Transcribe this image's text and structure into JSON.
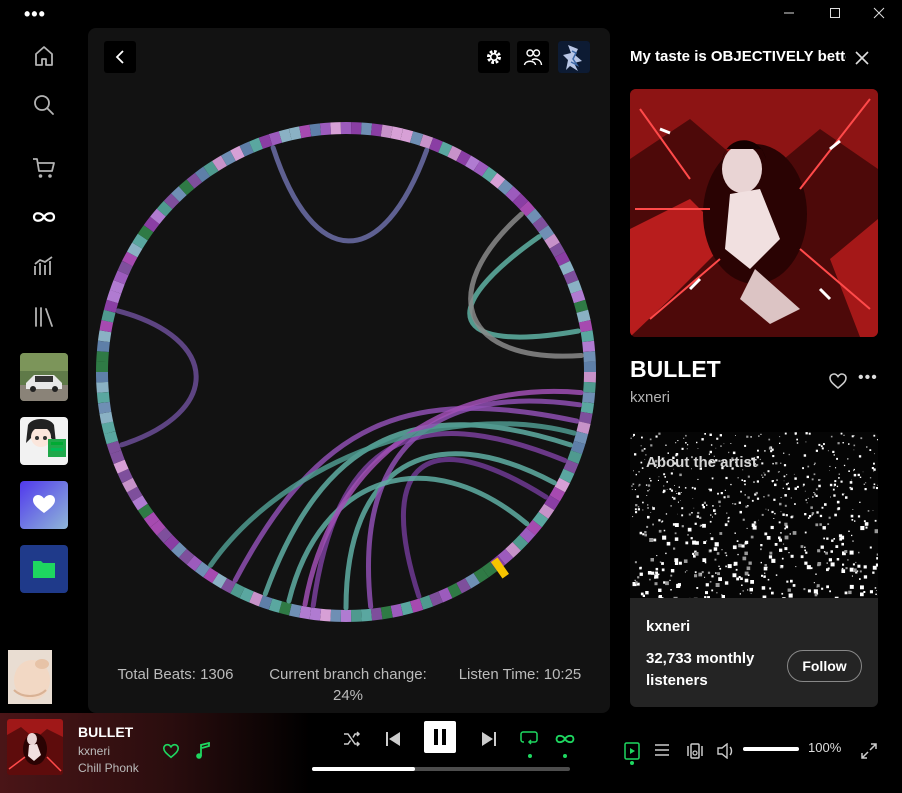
{
  "app": {
    "menu_icon": "three-dots-icon",
    "window_controls": [
      "minimize-icon",
      "maximize-icon",
      "close-icon"
    ]
  },
  "sidebar": {
    "items": [
      {
        "icon": "home-icon"
      },
      {
        "icon": "search-icon"
      },
      {
        "icon": "cart-icon"
      },
      {
        "icon": "infinity-icon"
      },
      {
        "icon": "stats-icon"
      },
      {
        "icon": "library-icon"
      }
    ],
    "playlists": [
      {
        "icon": "car-playlist-thumb"
      },
      {
        "icon": "anime-playlist-thumb"
      },
      {
        "icon": "liked-songs-heart-icon",
        "color": "#7b5cf5"
      },
      {
        "icon": "local-files-folder-icon",
        "color": "#1f3a8a"
      }
    ]
  },
  "visualizer": {
    "toolbar": [
      "back-icon",
      "settings-icon",
      "users-icon",
      "profile-avatar"
    ],
    "total_beats": "Total Beats: 1306",
    "branch_change_label": "Current branch change:",
    "branch_change_value": "24%",
    "listen_time": "Listen Time: 10:25"
  },
  "right_panel": {
    "playlist_title": "My taste is OBJECTIVELY better",
    "song_title": "BULLET",
    "artist": "kxneri",
    "about_label": "About the artist",
    "about_artist_name": "kxneri",
    "monthly_listeners": "32,733 monthly listeners",
    "follow_label": "Follow"
  },
  "player": {
    "track_title": "BULLET",
    "track_artist": "kxneri",
    "track_genre": "Chill Phonk",
    "progress_fraction": 0.4,
    "volume_label": "100%",
    "volume_fraction": 1.0,
    "accent_color": "#1ed760"
  }
}
